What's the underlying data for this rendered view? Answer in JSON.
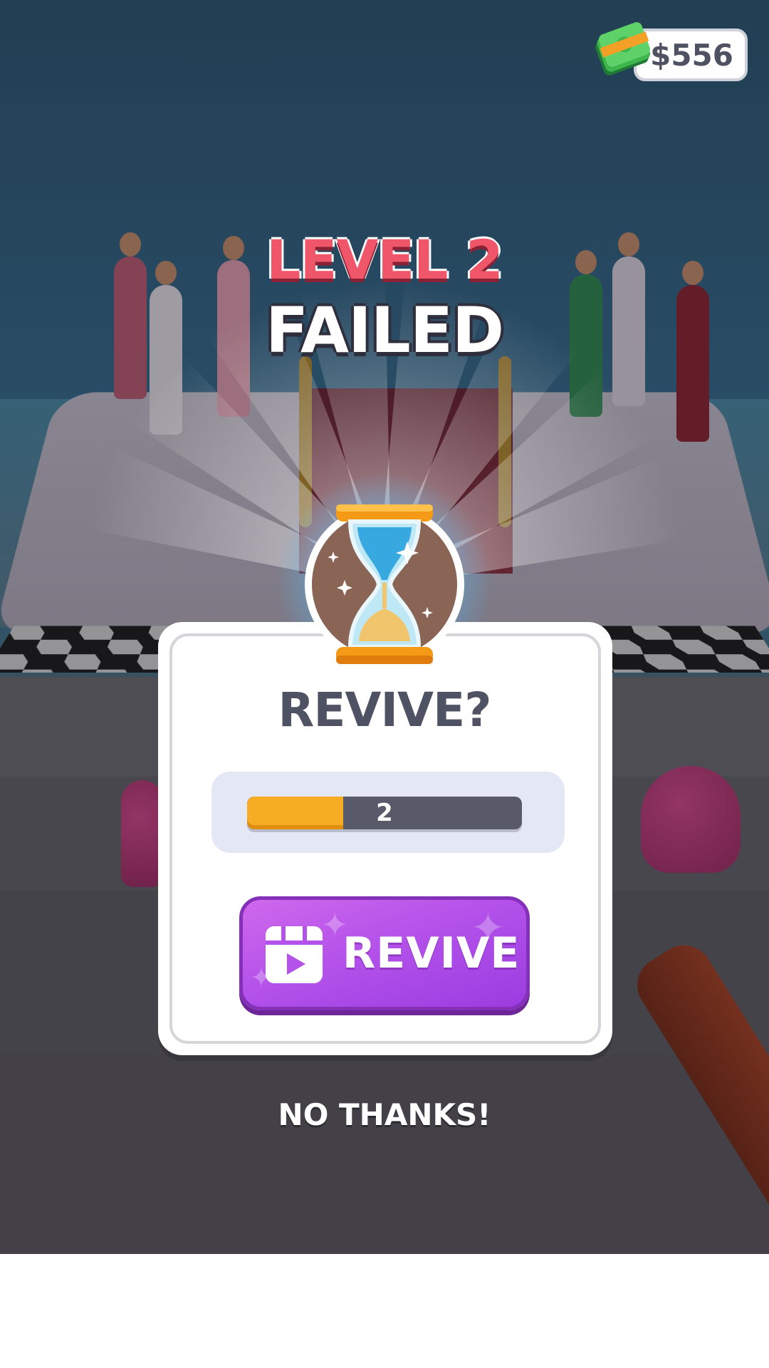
{
  "hud": {
    "money": "$556",
    "money_icon": "cash-icon"
  },
  "result": {
    "level_text": "LEVEL 2",
    "status_text": "FAILED"
  },
  "revive_dialog": {
    "title": "REVIVE?",
    "timer_value": "2",
    "timer_progress": 0.35,
    "revive_button_label": "REVIVE",
    "revive_button_icon": "video-ad-icon",
    "badge_icon": "hourglass-icon"
  },
  "footer": {
    "no_thanks_label": "NO THANKS!"
  },
  "colors": {
    "level_red": "#f0566a",
    "revive_purple": "#b452ea",
    "timer_orange": "#f6ad23",
    "dark_text": "#4f5263"
  }
}
